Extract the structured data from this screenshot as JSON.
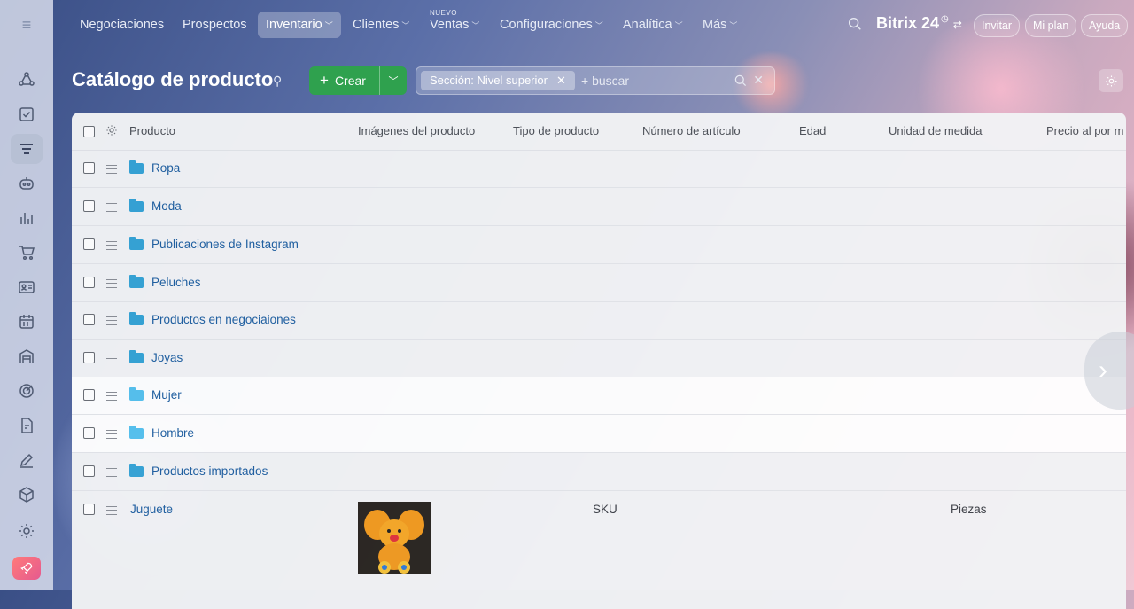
{
  "nav": {
    "items": [
      {
        "label": "Negociaciones",
        "chevron": false
      },
      {
        "label": "Prospectos",
        "chevron": false
      },
      {
        "label": "Inventario",
        "chevron": true,
        "active": true
      },
      {
        "label": "Clientes",
        "chevron": true
      },
      {
        "label": "Ventas",
        "chevron": true,
        "badge": "NUEVO"
      },
      {
        "label": "Configuraciones",
        "chevron": true
      },
      {
        "label": "Analítica",
        "chevron": true
      },
      {
        "label": "Más",
        "chevron": true
      }
    ],
    "brand": "Bitrix 24",
    "invite": "Invitar",
    "my_plan": "Mi plan",
    "help": "Ayuda"
  },
  "sidebar": {
    "icons": [
      "crm-icon",
      "tasks-icon",
      "inventory-icon",
      "robot-icon",
      "analytics-icon",
      "cart-icon",
      "contact-card-icon",
      "calendar-icon",
      "warehouse-icon",
      "target-icon",
      "document-sign-icon",
      "pen-icon",
      "box-icon",
      "settings-icon",
      "rocket-icon"
    ]
  },
  "page": {
    "title": "Catálogo de producto",
    "create_label": "Crear",
    "filter_tag": "Sección: Nivel superior",
    "search_placeholder": "+ buscar"
  },
  "table": {
    "columns": [
      "Producto",
      "Imágenes del producto",
      "Tipo de producto",
      "Número de artículo",
      "Edad",
      "Unidad de medida",
      "Precio al por m"
    ],
    "rows": [
      {
        "name": "Ropa",
        "type": "folder"
      },
      {
        "name": "Moda",
        "type": "folder"
      },
      {
        "name": "Publicaciones de Instagram",
        "type": "folder"
      },
      {
        "name": "Peluches",
        "type": "folder"
      },
      {
        "name": "Productos en negociaiones",
        "type": "folder"
      },
      {
        "name": "Joyas",
        "type": "folder"
      },
      {
        "name": "Mujer",
        "type": "folder",
        "highlighted": true
      },
      {
        "name": "Hombre",
        "type": "folder",
        "highlighted": true
      },
      {
        "name": "Productos importados",
        "type": "folder"
      },
      {
        "name": "Juguete",
        "type": "product",
        "product_type": "SKU",
        "unit": "Piezas"
      }
    ]
  }
}
